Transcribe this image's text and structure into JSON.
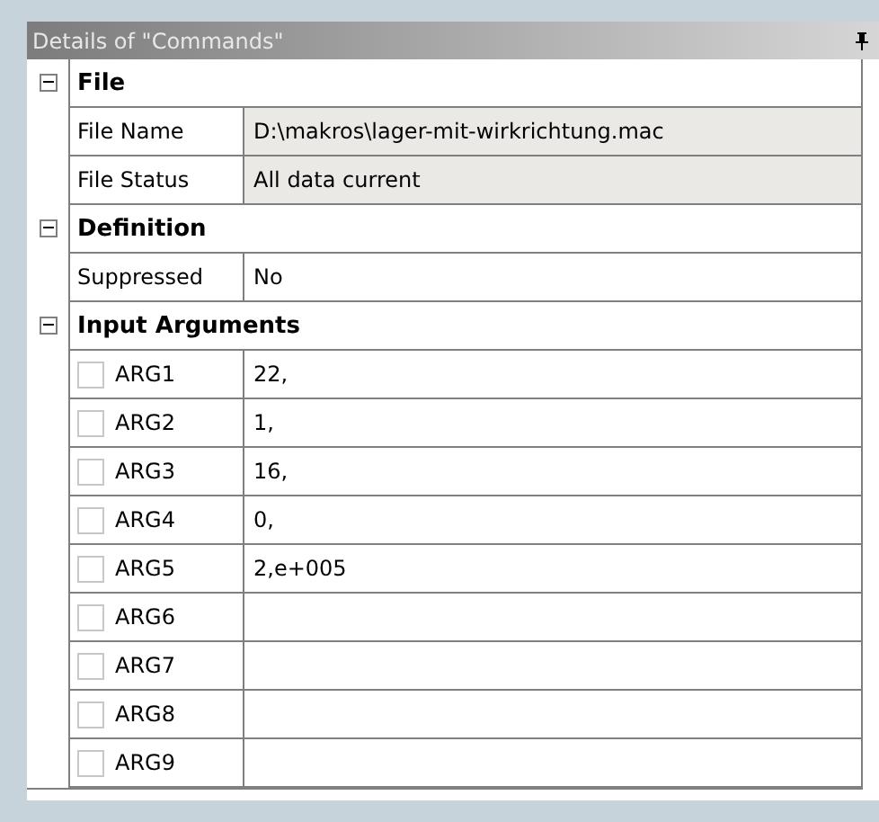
{
  "panel": {
    "title": "Details of \"Commands\""
  },
  "sections": [
    {
      "title": "File",
      "expanded": true,
      "rows": [
        {
          "kind": "plain",
          "label": "File Name",
          "value": "D:\\makros\\lager-mit-wirkrichtung.mac",
          "readonly": true
        },
        {
          "kind": "plain",
          "label": "File Status",
          "value": "All data current",
          "readonly": true
        }
      ]
    },
    {
      "title": "Definition",
      "expanded": true,
      "rows": [
        {
          "kind": "plain",
          "label": "Suppressed",
          "value": "No",
          "readonly": false
        }
      ]
    },
    {
      "title": "Input Arguments",
      "expanded": true,
      "rows": [
        {
          "kind": "checkbox",
          "label": "ARG1",
          "value": "22,",
          "checked": false
        },
        {
          "kind": "checkbox",
          "label": "ARG2",
          "value": "1,",
          "checked": false
        },
        {
          "kind": "checkbox",
          "label": "ARG3",
          "value": "16,",
          "checked": false
        },
        {
          "kind": "checkbox",
          "label": "ARG4",
          "value": "0,",
          "checked": false
        },
        {
          "kind": "checkbox",
          "label": "ARG5",
          "value": "2,e+005",
          "checked": false
        },
        {
          "kind": "checkbox",
          "label": "ARG6",
          "checked": false
        },
        {
          "kind": "checkbox",
          "label": "ARG7",
          "checked": false
        },
        {
          "kind": "checkbox",
          "label": "ARG8",
          "checked": false
        },
        {
          "kind": "checkbox",
          "label": "ARG9",
          "checked": false
        }
      ]
    }
  ]
}
